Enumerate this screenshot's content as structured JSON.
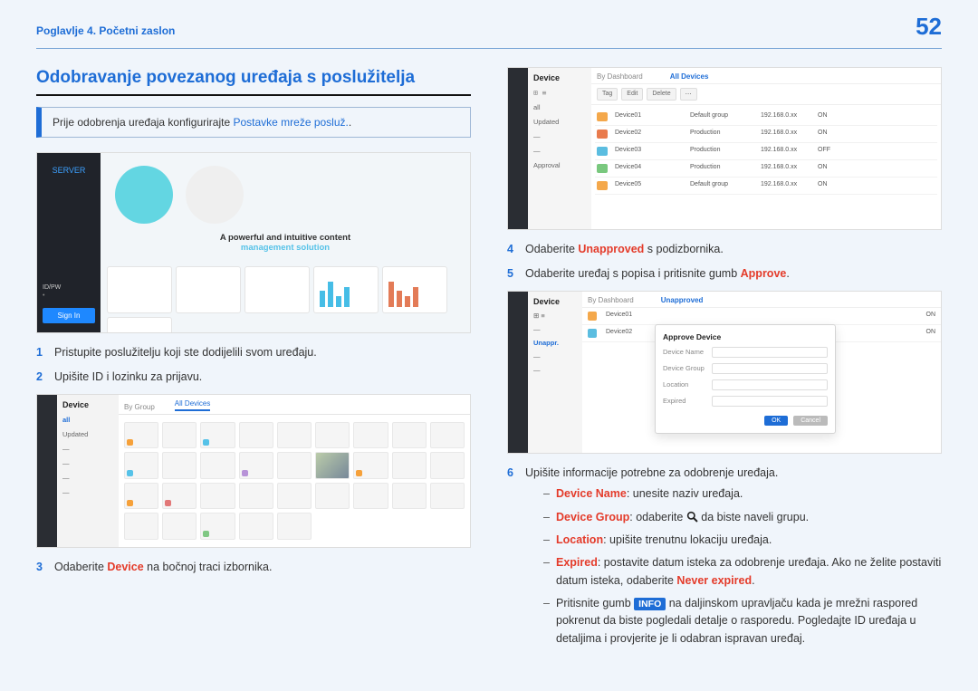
{
  "header": {
    "chapter": "Poglavlje 4. Početni zaslon",
    "page_number": "52"
  },
  "section_title": "Odobravanje povezanog uređaja s poslužitelja",
  "note": {
    "text_before": "Prije odobrenja uređaja konfigurirajte ",
    "link_text": "Postavke mreže posluž.",
    "text_after": "."
  },
  "fig1": {
    "logo_text": "SERVER",
    "id_label": "ID/PW",
    "login_btn": "Sign In",
    "banner_line1": "A powerful and intuitive content",
    "banner_line2": "management solution"
  },
  "fig2": {
    "side_title": "Device",
    "side_items": [
      "all",
      "Updated",
      "",
      "",
      "",
      ""
    ],
    "tab1": "By Group",
    "tab2": "All Devices"
  },
  "fig3": {
    "side_title": "Device",
    "side_sub": [
      "all",
      "Updated",
      "",
      "",
      "",
      "Approval"
    ],
    "tab1": "By Dashboard",
    "tab2": "All Devices",
    "rows": [
      {
        "name": "Device01",
        "group": "Default group",
        "ip": "192.168.0.xx",
        "status": "ON"
      },
      {
        "name": "Device02",
        "group": "Production",
        "ip": "192.168.0.xx",
        "status": "ON"
      },
      {
        "name": "Device03",
        "group": "Production",
        "ip": "192.168.0.xx",
        "status": "OFF"
      },
      {
        "name": "Device04",
        "group": "Production",
        "ip": "192.168.0.xx",
        "status": "ON"
      },
      {
        "name": "Device05",
        "group": "Default group",
        "ip": "192.168.0.xx",
        "status": "ON"
      }
    ]
  },
  "fig4": {
    "side_title": "Device",
    "tab_active": "Unapproved",
    "modal_title": "Approve Device",
    "fields": [
      "Device Name",
      "Device Group",
      "Location",
      "Expired"
    ],
    "btn_ok": "OK",
    "btn_cancel": "Cancel"
  },
  "steps_left": {
    "s1": "Pristupite poslužitelju koji ste dodijelili svom uređaju.",
    "s2": "Upišite ID i lozinku za prijavu.",
    "s3_before": "Odaberite ",
    "s3_red": "Device",
    "s3_after": " na bočnoj traci izbornika."
  },
  "steps_right": {
    "s4_before": "Odaberite ",
    "s4_red": "Unapproved",
    "s4_after": " s podizbornika.",
    "s5_before": "Odaberite uređaj s popisa i pritisnite gumb ",
    "s5_red": "Approve",
    "s5_after": ".",
    "s6": "Upišite informacije potrebne za odobrenje uređaja.",
    "sub1_red": "Device Name",
    "sub1_after": ": unesite naziv uređaja.",
    "sub2_red": "Device Group",
    "sub2_mid": ": odaberite ",
    "sub2_after": " da biste naveli grupu.",
    "sub3_red": "Location",
    "sub3_after": ": upišite trenutnu lokaciju uređaja.",
    "sub4_red": "Expired",
    "sub4_mid": ": postavite datum isteka za odobrenje uređaja. Ako ne želite postaviti datum isteka, odaberite ",
    "sub4_red2": "Never expired",
    "sub4_after": ".",
    "sub5_before": "Pritisnite gumb ",
    "sub5_badge": "INFO",
    "sub5_after": " na daljinskom upravljaču kada je mrežni raspored pokrenut da biste pogledali detalje o rasporedu. Pogledajte ID uređaja u detaljima i provjerite je li odabran ispravan uređaj."
  }
}
